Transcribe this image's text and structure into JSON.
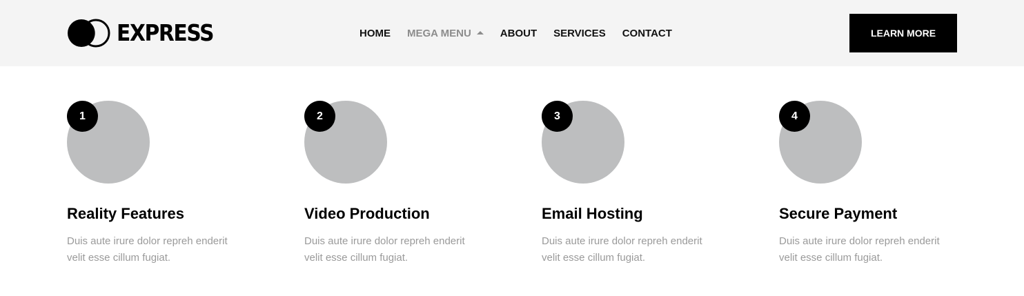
{
  "header": {
    "logo": {
      "text": "EXPRESS",
      "icon": "overlapping-circles-logo-icon"
    },
    "nav": [
      {
        "label": "HOME"
      },
      {
        "label": "MEGA MENU",
        "icon": "caret-up-icon"
      },
      {
        "label": "ABOUT"
      },
      {
        "label": "SERVICES"
      },
      {
        "label": "CONTACT"
      }
    ],
    "cta_label": "LEARN MORE"
  },
  "features": [
    {
      "number": "1",
      "title": "Reality Features",
      "description": "Duis aute irure dolor repreh enderit velit esse cillum fugiat."
    },
    {
      "number": "2",
      "title": "Video Production",
      "description": "Duis aute irure dolor repreh enderit velit esse cillum fugiat."
    },
    {
      "number": "3",
      "title": "Email Hosting",
      "description": "Duis aute irure dolor repreh enderit velit esse cillum fugiat."
    },
    {
      "number": "4",
      "title": "Secure Payment",
      "description": "Duis aute irure dolor repreh enderit velit esse cillum fugiat."
    }
  ],
  "colors": {
    "header_bg": "#f4f4f4",
    "accent": "#000000",
    "placeholder_circle": "#bdbebf",
    "muted_text": "#9a9a9a"
  }
}
